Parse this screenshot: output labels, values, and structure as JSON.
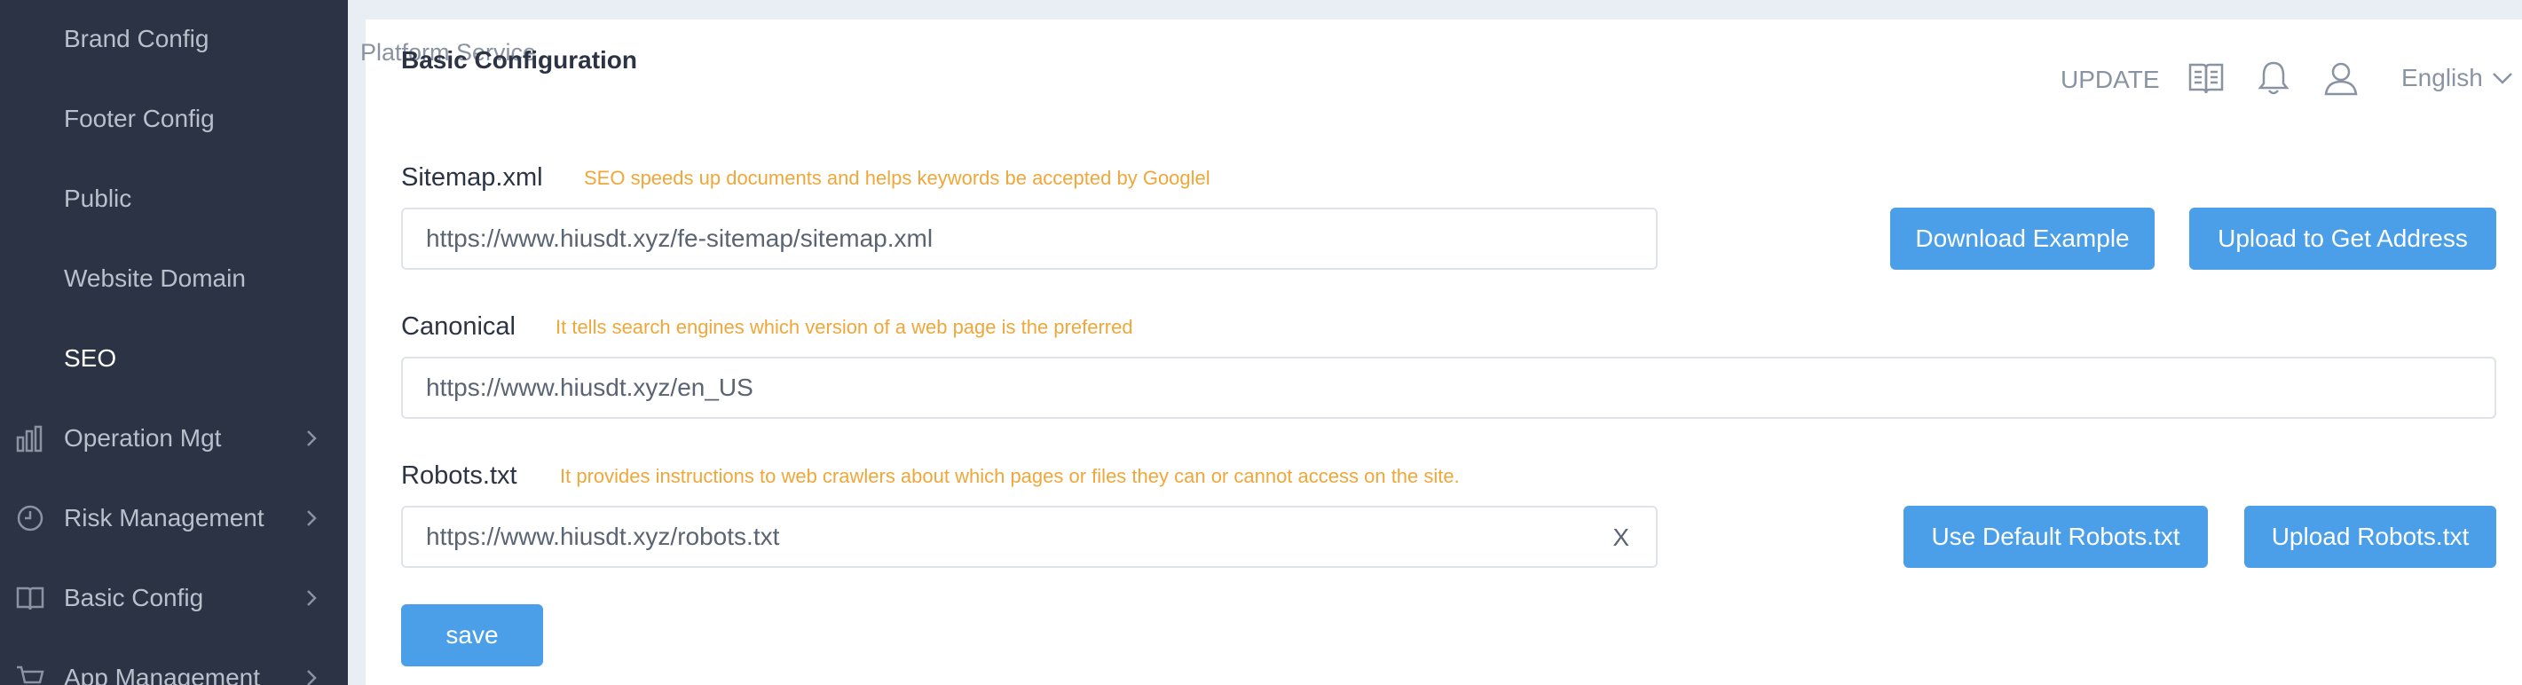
{
  "sidebar": {
    "items": [
      {
        "label": "Brand Config",
        "icon": "",
        "active": false
      },
      {
        "label": "Footer Config",
        "icon": "",
        "active": false
      },
      {
        "label": "Public",
        "icon": "",
        "active": false
      },
      {
        "label": "Website Domain",
        "icon": "",
        "active": false
      },
      {
        "label": "SEO",
        "icon": "",
        "active": true
      },
      {
        "label": "Operation Mgt",
        "icon": "bar-chart-icon",
        "active": false
      },
      {
        "label": "Risk Management",
        "icon": "clock-icon",
        "active": false
      },
      {
        "label": "Basic Config",
        "icon": "book-icon",
        "active": false
      },
      {
        "label": "App Management",
        "icon": "cart-icon",
        "active": false
      }
    ]
  },
  "header": {
    "platform_ghost": "Platform Service",
    "title": "Basic Configuration",
    "update_label": "UPDATE",
    "language": "English"
  },
  "form": {
    "sitemap": {
      "label": "Sitemap.xml",
      "hint": "SEO speeds up documents and helps keywords be accepted by Googlel",
      "value": "https://www.hiusdt.xyz/fe-sitemap/sitemap.xml",
      "download_label": "Download Example",
      "upload_label": "Upload to Get Address"
    },
    "canonical": {
      "label": "Canonical",
      "hint": "It tells search engines which version of a web page is the preferred",
      "value": "https://www.hiusdt.xyz/en_US"
    },
    "robots": {
      "label": "Robots.txt",
      "hint": "It provides instructions to web crawlers about which pages or files they can or cannot access on the site.",
      "value": "https://www.hiusdt.xyz/robots.txt",
      "clear_label": "X",
      "default_label": "Use Default Robots.txt",
      "upload_label": "Upload Robots.txt"
    },
    "save_label": "save"
  },
  "colors": {
    "sidebar_bg": "#2c3344",
    "accent": "#4a9fe8",
    "hint": "#f0a73a",
    "page_bg": "#e9eef5"
  }
}
